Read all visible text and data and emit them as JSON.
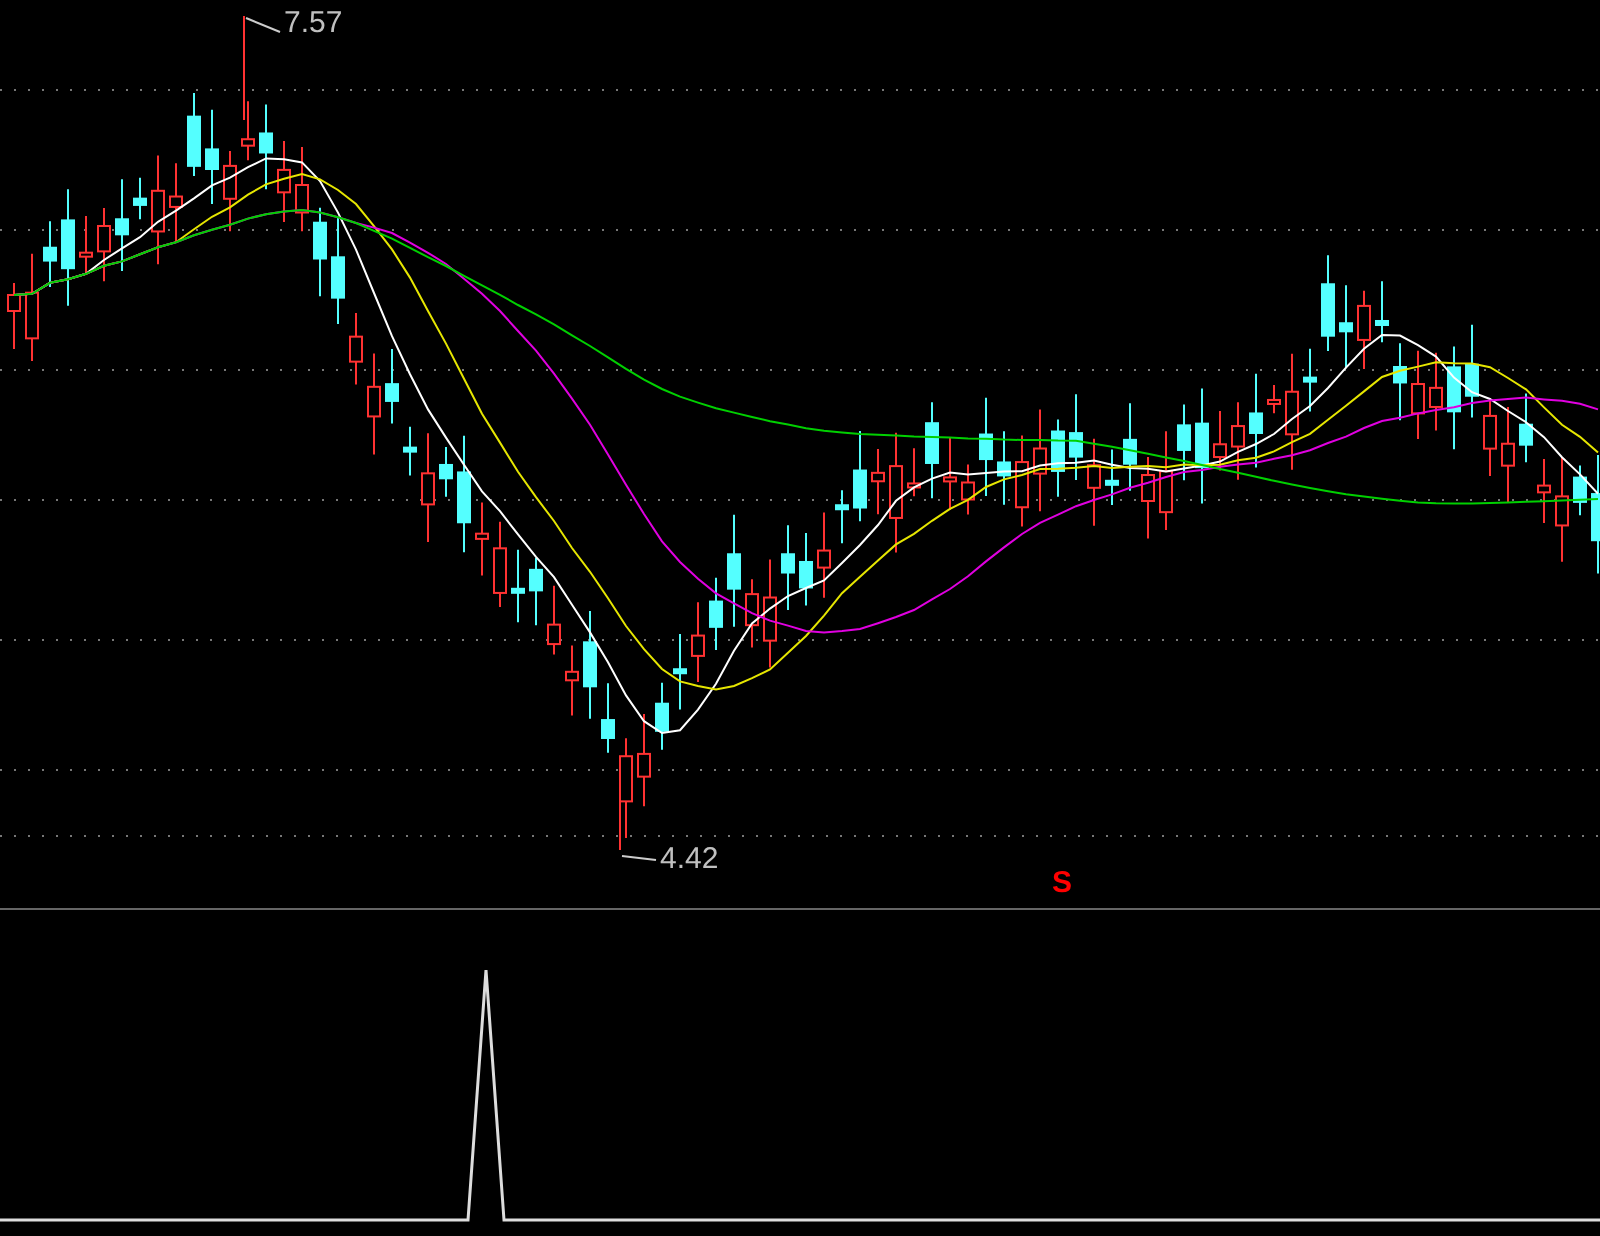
{
  "price_chart": {
    "high_label": "7.57",
    "low_label": "4.42",
    "signal_marker": "S"
  }
}
